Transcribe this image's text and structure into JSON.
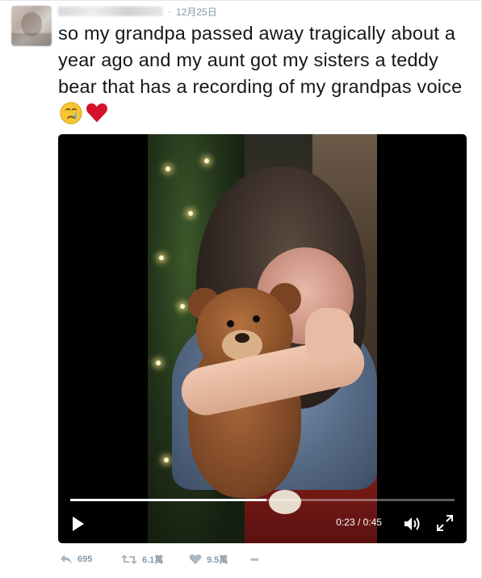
{
  "tweet": {
    "separator": "·",
    "date": "12月25日",
    "text": "so my grandpa passed away tragically about a year ago and my aunt got my sisters a teddy bear that has a recording of my grandpas voice",
    "emoji": [
      "crying-face",
      "red-heart"
    ]
  },
  "video": {
    "current_time": "0:23",
    "duration": "0:45",
    "time_display": "0:23 / 0:45",
    "progress_fraction": 0.51
  },
  "actions": {
    "replies": "695",
    "retweets": "6.1萬",
    "likes": "9.5萬",
    "more": "•••"
  },
  "colors": {
    "text": "#14171a",
    "meta": "#8899a6",
    "heart": "#e0245e",
    "video_bg": "#000000"
  }
}
